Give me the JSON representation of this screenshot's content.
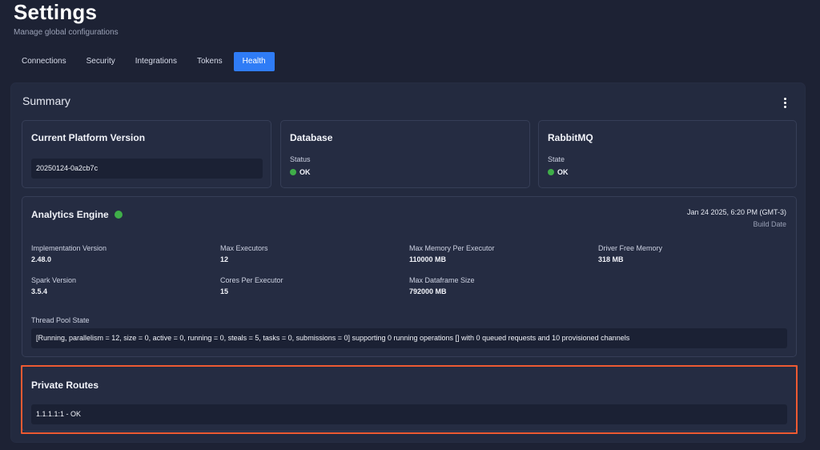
{
  "header": {
    "title": "Settings",
    "subtitle": "Manage global configurations"
  },
  "tabs": [
    {
      "label": "Connections",
      "active": false
    },
    {
      "label": "Security",
      "active": false
    },
    {
      "label": "Integrations",
      "active": false
    },
    {
      "label": "Tokens",
      "active": false
    },
    {
      "label": "Health",
      "active": true
    }
  ],
  "summary": {
    "title": "Summary",
    "menu_icon": "more-vertical-icon",
    "platform_version": {
      "title": "Current Platform Version",
      "value": "20250124-0a2cb7c"
    },
    "database": {
      "title": "Database",
      "status_label": "Status",
      "status_value": "OK"
    },
    "rabbitmq": {
      "title": "RabbitMQ",
      "state_label": "State",
      "state_value": "OK"
    },
    "analytics_engine": {
      "title": "Analytics Engine",
      "build_date": "Jan 24 2025, 6:20 PM (GMT-3)",
      "build_date_label": "Build Date",
      "fields": [
        {
          "label": "Implementation Version",
          "value": "2.48.0"
        },
        {
          "label": "Max Executors",
          "value": "12"
        },
        {
          "label": "Max Memory Per Executor",
          "value": "110000 MB"
        },
        {
          "label": "Driver Free Memory",
          "value": "318 MB"
        },
        {
          "label": "Spark Version",
          "value": "3.5.4"
        },
        {
          "label": "Cores Per Executor",
          "value": "15"
        },
        {
          "label": "Max Dataframe Size",
          "value": "792000 MB"
        }
      ],
      "thread_pool_label": "Thread Pool State",
      "thread_pool_value": "[Running, parallelism = 12, size = 0, active = 0, running = 0, steals = 5, tasks = 0, submissions = 0] supporting 0 running operations [] with 0 queued requests and 10 provisioned channels"
    },
    "private_routes": {
      "title": "Private Routes",
      "value": "1.1.1.1:1 - OK"
    }
  },
  "colors": {
    "accent": "#2f7cf6",
    "status_ok": "#3fae49",
    "highlight": "#ee5a32",
    "background": "#1d2234",
    "panel": "#232a3f"
  }
}
